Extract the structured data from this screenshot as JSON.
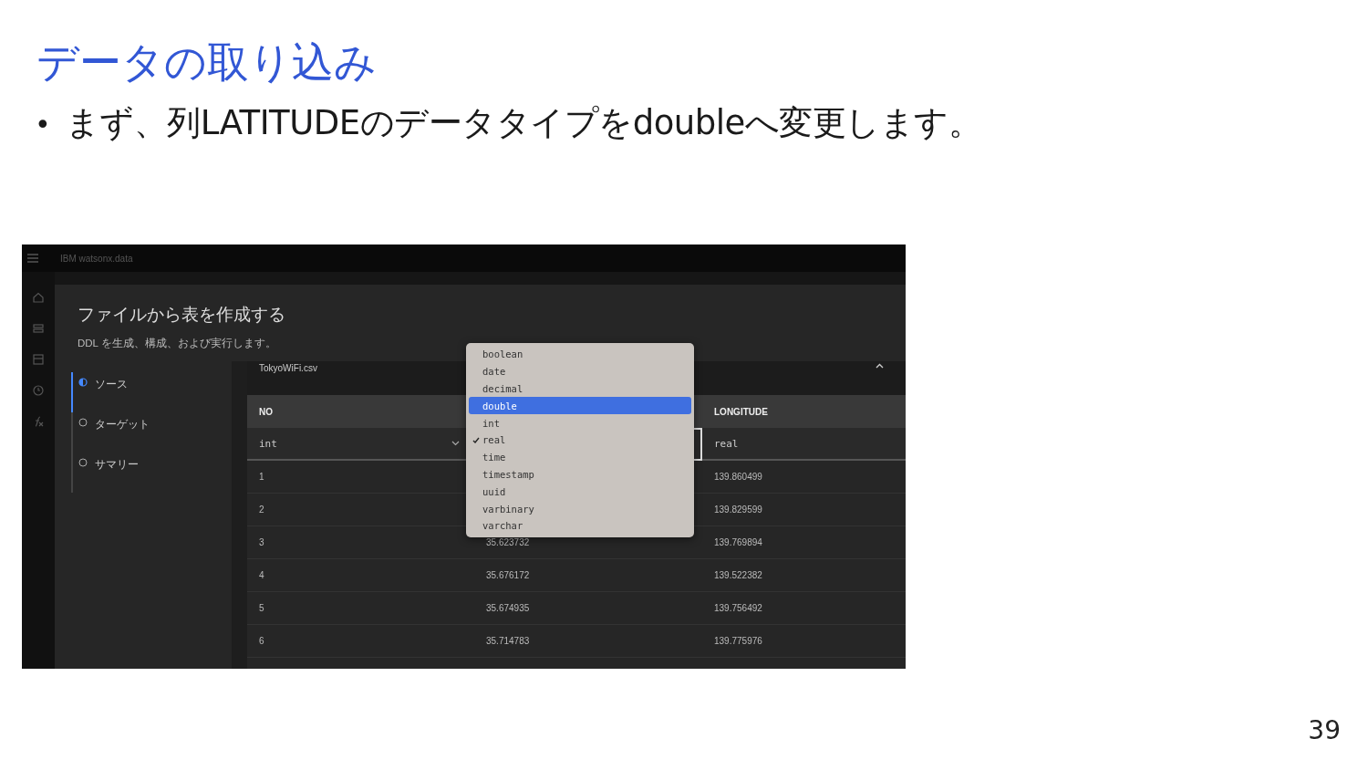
{
  "slide": {
    "title": "データの取り込み",
    "bullet_mark": "•",
    "bullet": "まず、列LATITUDEのデータタイプをdoubleへ変更します。",
    "page_number": "39"
  },
  "screenshot": {
    "app_name": "IBM watsonx.data",
    "heading": "ファイルから表を作成する",
    "subheading": "DDL を生成、構成、および実行します。",
    "steps": [
      {
        "label": "ソース",
        "current": true
      },
      {
        "label": "ターゲット",
        "current": false
      },
      {
        "label": "サマリー",
        "current": false
      }
    ],
    "file_name": "TokyoWiFi.csv",
    "file_expanded": true,
    "columns": [
      {
        "name": "NO",
        "type": "int",
        "focused": false,
        "chevron": true
      },
      {
        "focused": true,
        "chevron": false
      },
      {
        "name": "LONGITUDE",
        "type": "real",
        "focused": false,
        "chevron": false
      }
    ],
    "rows": [
      {
        "no": "1",
        "longitude": "139.860499"
      },
      {
        "no": "2",
        "longitude": "139.829599"
      },
      {
        "no": "3",
        "latitude": "35.623732",
        "longitude": "139.769894"
      },
      {
        "no": "4",
        "latitude": "35.676172",
        "longitude": "139.522382"
      },
      {
        "no": "5",
        "latitude": "35.674935",
        "longitude": "139.756492"
      },
      {
        "no": "6",
        "latitude": "35.714783",
        "longitude": "139.775976"
      }
    ],
    "type_menu": [
      {
        "label": "boolean",
        "highlighted": false,
        "checked": false
      },
      {
        "label": "date",
        "highlighted": false,
        "checked": false
      },
      {
        "label": "decimal",
        "highlighted": false,
        "checked": false
      },
      {
        "label": "double",
        "highlighted": true,
        "checked": false
      },
      {
        "label": "int",
        "highlighted": false,
        "checked": false
      },
      {
        "label": "real",
        "highlighted": false,
        "checked": true
      },
      {
        "label": "time",
        "highlighted": false,
        "checked": false
      },
      {
        "label": "timestamp",
        "highlighted": false,
        "checked": false
      },
      {
        "label": "uuid",
        "highlighted": false,
        "checked": false
      },
      {
        "label": "varbinary",
        "highlighted": false,
        "checked": false
      },
      {
        "label": "varchar",
        "highlighted": false,
        "checked": false
      }
    ]
  }
}
